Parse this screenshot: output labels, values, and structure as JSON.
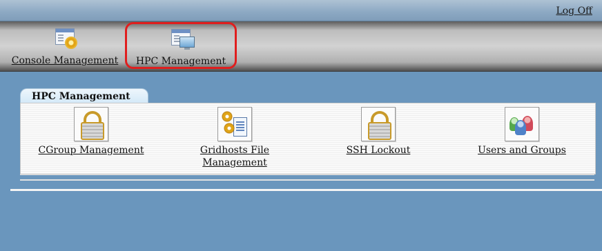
{
  "header": {
    "logoff_label": "Log Off"
  },
  "app_tabs": [
    {
      "label": "Console Management",
      "icon": "console-settings-icon"
    },
    {
      "label": "HPC Management",
      "icon": "hpc-monitor-icon",
      "highlighted": true,
      "highlight_color": "#e01e1e"
    }
  ],
  "panel": {
    "tab_label": "HPC Management",
    "items": [
      {
        "label": "CGroup Management",
        "icon": "padlock-icon"
      },
      {
        "label_line1": "Gridhosts File",
        "label_line2": "Management",
        "icon": "gears-document-icon"
      },
      {
        "label": "SSH Lockout",
        "icon": "padlock-icon"
      },
      {
        "label": "Users and Groups",
        "icon": "users-icon"
      }
    ]
  },
  "colors": {
    "background": "#6a96bd",
    "highlight": "#e01e1e"
  }
}
